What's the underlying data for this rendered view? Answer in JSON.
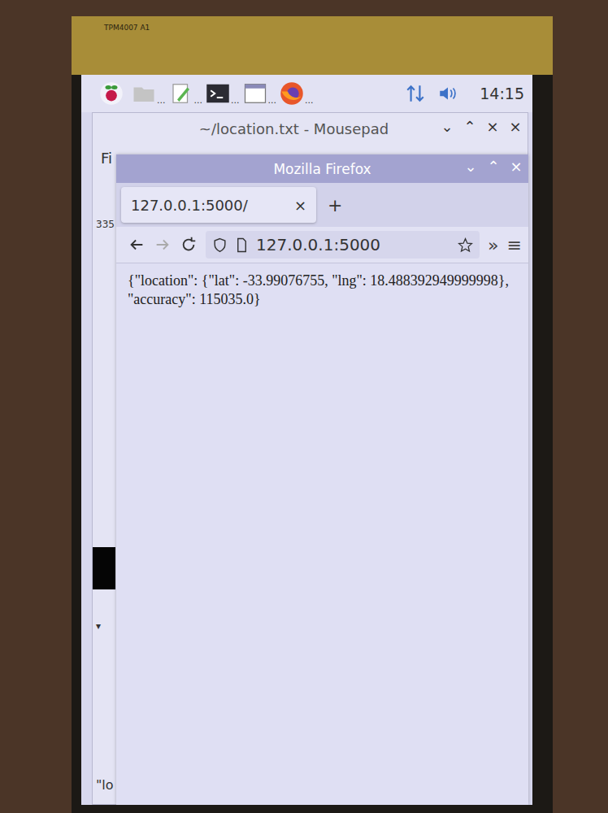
{
  "bezel_label": "TPM4007 A1",
  "taskbar": {
    "launchers": [
      {
        "label": "..."
      },
      {
        "label": "..."
      },
      {
        "label": "..."
      },
      {
        "label": "..."
      },
      {
        "label": "..."
      }
    ],
    "time": "14:15"
  },
  "editor": {
    "title": "~/location.txt - Mousepad",
    "controls": [
      "⌄",
      "⌃",
      "×",
      "×"
    ],
    "menu": "Fi",
    "line_number": "335",
    "fold": "▾",
    "text": "\"lo"
  },
  "browser": {
    "title": "Mozilla Firefox",
    "controls": [
      "⌄",
      "⌃",
      "×"
    ],
    "tabs": [
      {
        "label": "127.0.0.1:5000/",
        "selected": true
      }
    ],
    "tab_close": "×",
    "new_tab": "+",
    "url": "127.0.0.1:5000",
    "overflow": "»",
    "menu": "≡",
    "content": "{\"location\": {\"lat\": -33.99076755, \"lng\": 18.488392949999998}, \"accuracy\": 115035.0}"
  }
}
